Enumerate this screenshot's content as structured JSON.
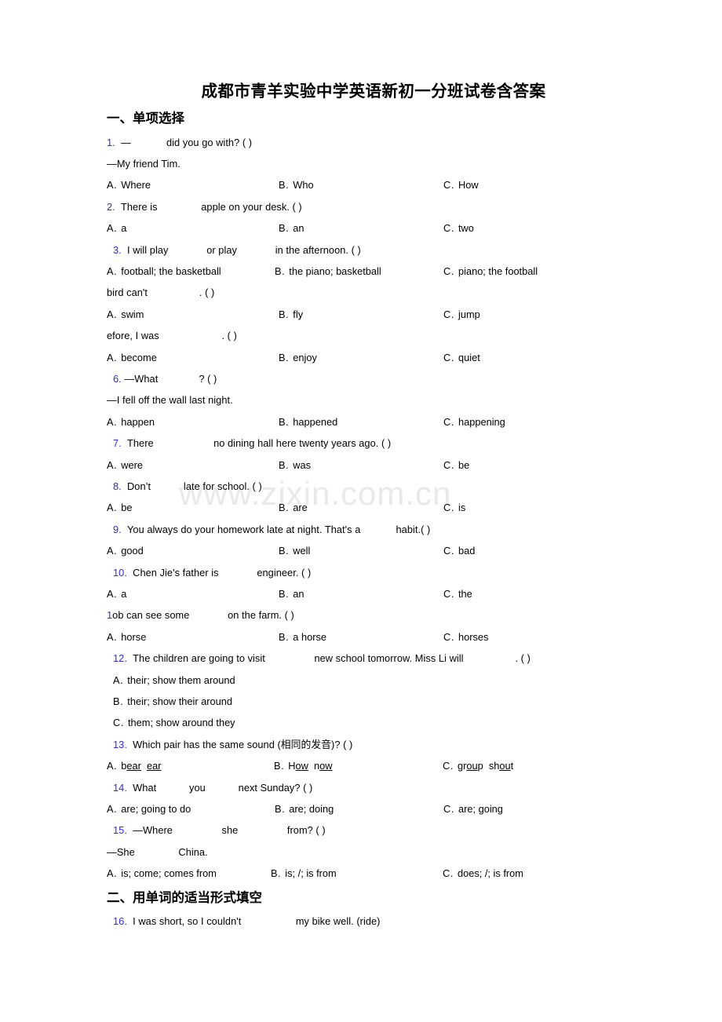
{
  "document": {
    "title": "成都市青羊实验中学英语新初一分班试卷含答案",
    "watermark": "www.zixin.com.cn"
  },
  "sections": [
    {
      "id": "section-1",
      "heading": "一、单项选择"
    },
    {
      "id": "section-2",
      "heading": "二、用单词的适当形式填空"
    }
  ],
  "questions": {
    "q1": {
      "number": "1.",
      "stem_pre": "—",
      "blank": "______",
      "stem_post": " did you go with? (   )",
      "answer_line": "—My friend Tim.",
      "options": {
        "a_label": "A.",
        "a_text": "Where",
        "b_label": "B.",
        "b_text": "Who",
        "c_label": "C.",
        "c_text": "How"
      }
    },
    "q2": {
      "number": "2.",
      "stem_pre": "There is ",
      "blank": "_______",
      "stem_post": " apple on your desk. (   )",
      "options": {
        "a_label": "A.",
        "a_text": "a",
        "b_label": "B.",
        "b_text": "an",
        "c_label": "C.",
        "c_text": "two"
      }
    },
    "q3": {
      "number": "3.",
      "stem_pre": "I will play ",
      "blank": "______",
      "stem_mid": " or play ",
      "blank2": "______",
      "stem_post": " in the afternoon. (  )",
      "options": {
        "a_label": "A.",
        "a_text": "football; the basketball",
        "b_label": "B.",
        "b_text": "the piano; basketball",
        "c_label": "C.",
        "c_text": "piano; the football"
      }
    },
    "q4": {
      "number": "",
      "stem_pre": " bird can't ",
      "blank": "_________",
      "stem_post": ". (  )",
      "options": {
        "a_label": "A.",
        "a_text": "swim",
        "b_label": "B.",
        "b_text": "fly",
        "c_label": "C.",
        "c_text": "jump"
      }
    },
    "q5": {
      "number": "",
      "stem_pre": "efore, I was ",
      "blank": "___________",
      "stem_post": ". (  )",
      "options": {
        "a_label": "A.",
        "a_text": "become",
        "b_label": "B.",
        "b_text": "enjoy",
        "c_label": "C.",
        "c_text": "quiet"
      }
    },
    "q6": {
      "number": "6.",
      "stem_pre": "—What ",
      "blank": "_______",
      "stem_post": "? (  )",
      "answer_line": "—I fell off the wall last night.",
      "options": {
        "a_label": "A.",
        "a_text": "happen",
        "b_label": "B.",
        "b_text": "happened",
        "c_label": "C.",
        "c_text": "happening"
      }
    },
    "q7": {
      "number": "7.",
      "stem_pre": "There ",
      "blank": "__________",
      "stem_post": " no dining hall here twenty years ago. (   )",
      "options": {
        "a_label": "A.",
        "a_text": "were",
        "b_label": "B.",
        "b_text": "was",
        "c_label": "C.",
        "c_text": "be"
      }
    },
    "q8": {
      "number": "8.",
      "stem_pre": "Don’t ",
      "blank": "_____",
      "stem_post": " late for school.  (  )",
      "options": {
        "a_label": "A.",
        "a_text": "be",
        "b_label": "B.",
        "b_text": "are",
        "c_label": "C.",
        "c_text": "is"
      }
    },
    "q9": {
      "number": "9.",
      "stem_pre": "You always do your homework late at night. That's a",
      "blank": "______",
      "stem_post": " habit.(  )",
      "options": {
        "a_label": "A.",
        "a_text": "good",
        "b_label": "B.",
        "b_text": "well",
        "c_label": "C.",
        "c_text": "bad"
      }
    },
    "q10": {
      "number": "10.",
      "stem_pre": "Chen Jie's father is ",
      "blank": "______",
      "stem_post": " engineer. (  )",
      "options": {
        "a_label": "A.",
        "a_text": "a",
        "b_label": "B.",
        "b_text": "an",
        "c_label": "C.",
        "c_text": "the"
      }
    },
    "q11": {
      "number": "1",
      "stem_pre": "ob can see some ",
      "blank": "______",
      "stem_post": " on the farm. (  )",
      "options": {
        "a_label": "A.",
        "a_text": "horse",
        "b_label": "B.",
        "b_text": "a horse",
        "c_label": "C.",
        "c_text": "horses"
      }
    },
    "q12": {
      "number": "12.",
      "stem_pre": "The children are going to visit ",
      "blank": "________",
      "stem_mid": " new school tomorrow. Miss Li will ",
      "blank2": "_________",
      "stem_post": ". (   )",
      "options_stacked": [
        {
          "label": "A.",
          "text": "their; show them around"
        },
        {
          "label": "B.",
          "text": "their; show their around"
        },
        {
          "label": "C.",
          "text": "them; show around they"
        }
      ]
    },
    "q13": {
      "number": "13.",
      "stem": "Which pair has the same sound (相同的发音)? (  )",
      "sound_options": {
        "a_label": "A.",
        "a_word1_pre": "b",
        "a_word1_ul": "ear",
        "a_word2_pre": "",
        "a_word2_ul": "ear",
        "b_label": "B.",
        "b_word1_pre": "H",
        "b_word1_ul": "ow",
        "b_word2_pre": "n",
        "b_word2_ul": "ow",
        "c_label": "C.",
        "c_word1_pre": "gr",
        "c_word1_ul": "ou",
        "c_word1_post": "p",
        "c_word2_pre": "sh",
        "c_word2_ul": "ou",
        "c_word2_post": "t"
      }
    },
    "q14": {
      "number": "14.",
      "stem_pre": "What ",
      "blank": "_____",
      "stem_mid": " you ",
      "blank2": "_____",
      "stem_post": " next Sunday? (  )",
      "options": {
        "a_label": "A.",
        "a_text": "are; going to do",
        "b_label": "B.",
        "b_text": "are; doing",
        "c_label": "C.",
        "c_text": "are; going"
      }
    },
    "q15": {
      "number": "15.",
      "stem_pre": "—Where ",
      "blank": "________",
      "stem_mid": " she ",
      "blank2": "________",
      "stem_post": " from? (  )",
      "answer_pre": "—She ",
      "answer_blank": "_______",
      "answer_post": " China.",
      "options": {
        "a_label": "A.",
        "a_text": "is; come; comes from",
        "b_label": "B.",
        "b_text": "is; /; is from",
        "c_label": "C.",
        "c_text": "does; /; is from"
      }
    },
    "q16": {
      "number": "16.",
      "stem_pre": "I was short, so I couldn't ",
      "blank": "_________",
      "stem_post": " my bike well. (ride)"
    }
  },
  "colors": {
    "question_number": "#2c2cdd",
    "text": "#000000",
    "watermark": "#e9e9e9",
    "background": "#ffffff"
  }
}
